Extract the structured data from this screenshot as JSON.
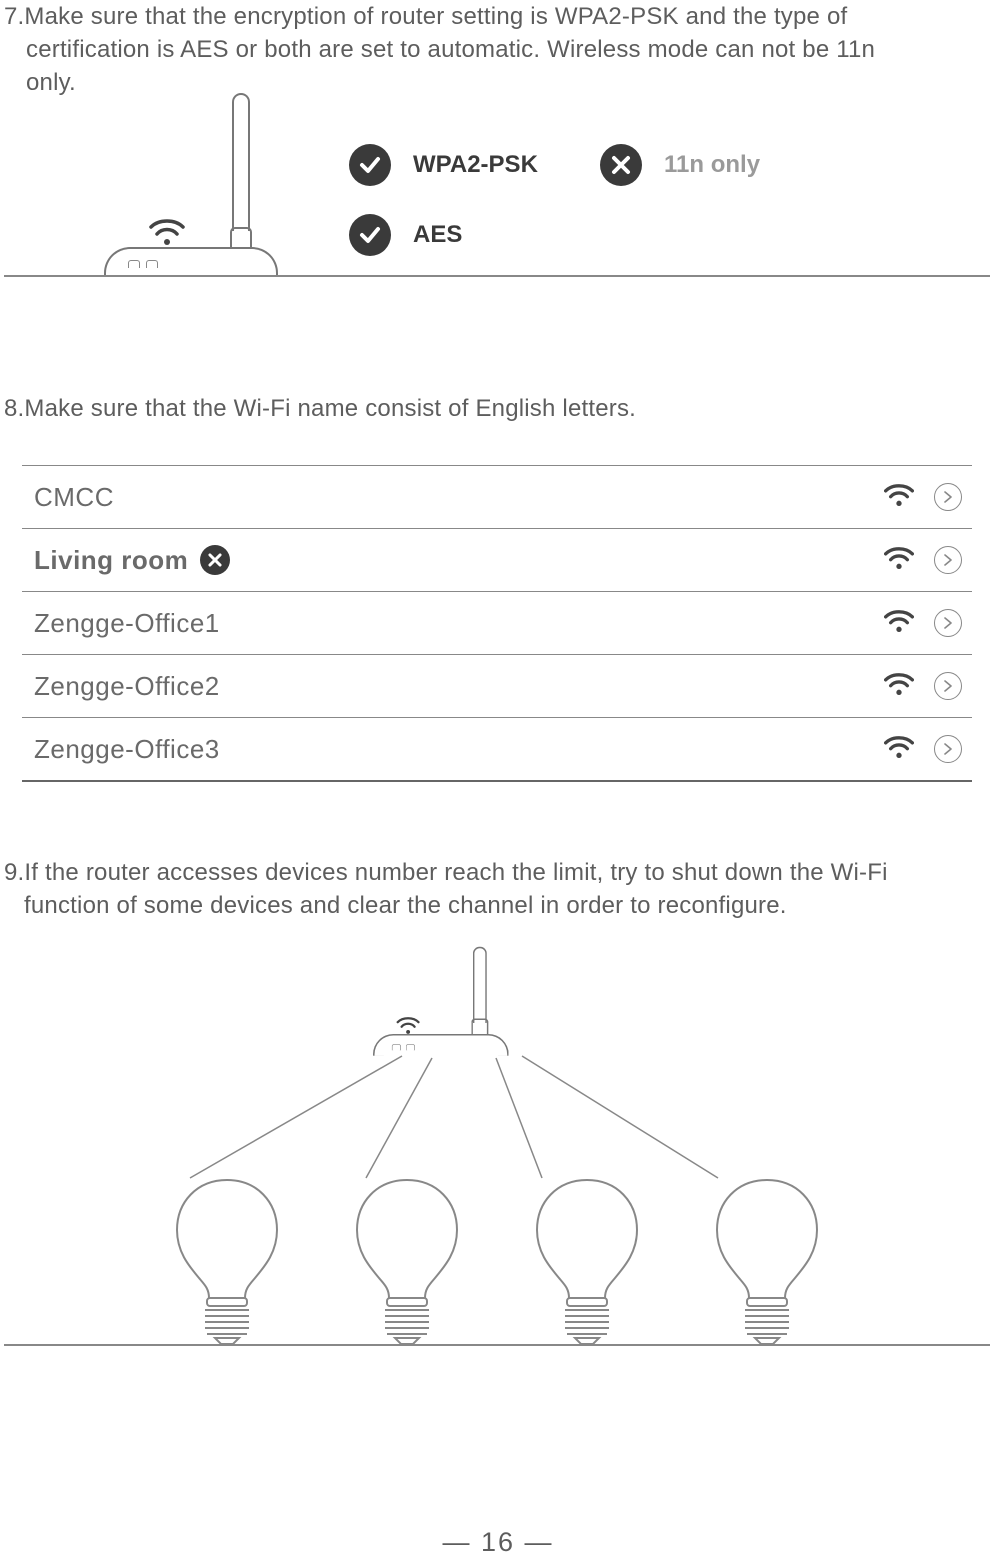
{
  "section7": {
    "l1": "7.Make sure that the encryption of router setting is WPA2-PSK and the type of",
    "l2": "certification is AES or both are set to automatic. Wireless mode can not be 11n",
    "l3": "only.",
    "opt_wpa": "WPA2-PSK",
    "opt_aes": "AES",
    "opt_11n": "11n only"
  },
  "section8": {
    "text": "8.Make sure that the Wi-Fi name consist of English letters.",
    "rows": [
      {
        "label": "CMCC",
        "bold": false,
        "bad": false
      },
      {
        "label": "Living room",
        "bold": true,
        "bad": true
      },
      {
        "label": "Zengge-Office1",
        "bold": false,
        "bad": false
      },
      {
        "label": "Zengge-Office2",
        "bold": false,
        "bad": false
      },
      {
        "label": "Zengge-Office3",
        "bold": false,
        "bad": false
      }
    ]
  },
  "section9": {
    "l1": "9.If the router accesses devices number reach the limit, try to shut down the Wi-Fi",
    "l2": "function of some devices and clear the channel in order to reconfigure."
  },
  "page_number": "— 16 —"
}
